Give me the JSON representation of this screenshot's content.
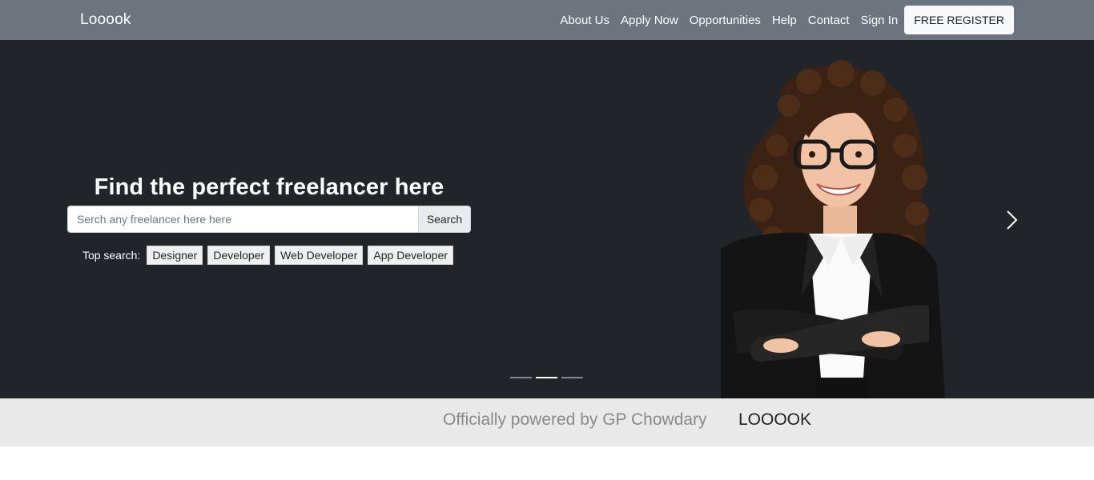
{
  "navbar": {
    "brand": "Looook",
    "links": [
      "About Us",
      "Apply Now",
      "Opportunities",
      "Help",
      "Contact",
      "Sign In"
    ],
    "register_label": "FREE REGISTER"
  },
  "hero": {
    "title": "Find the perfect freelancer here",
    "search": {
      "placeholder": "Serch any freelancer here here",
      "button_label": "Search"
    },
    "top_search": {
      "label": "Top search:",
      "tags": [
        "Designer",
        "Developer",
        "Web Developer",
        "App Developer"
      ]
    },
    "carousel": {
      "slide_count": 3,
      "active_slide": 2,
      "next_icon": "chevron-right-icon"
    }
  },
  "powered": {
    "text": "Officially powered by GP Chowdary",
    "brand": "LOOOOK"
  },
  "colors": {
    "navbar_bg": "#6c757d",
    "hero_bg": "#212429",
    "band_bg": "#e9e9e9"
  }
}
